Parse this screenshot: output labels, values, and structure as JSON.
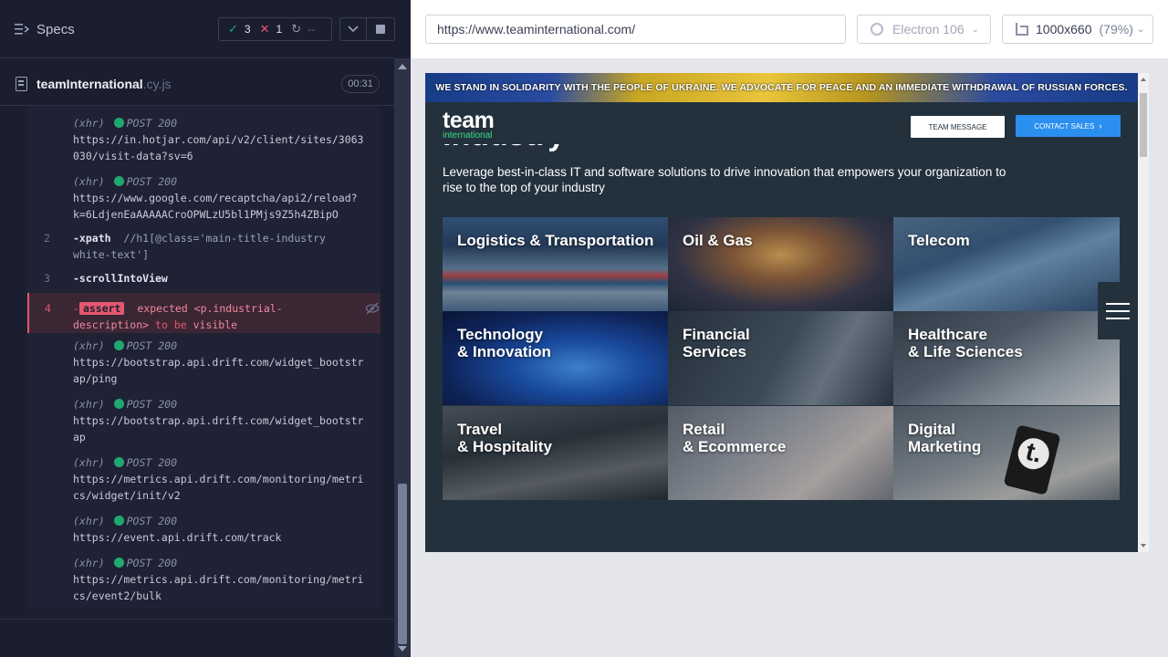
{
  "reporter": {
    "specs_label": "Specs",
    "stats": {
      "passed": "3",
      "failed": "1",
      "pending": "--"
    },
    "spec": {
      "name": "teamInternational",
      "ext": ".cy.js",
      "time": "00:31"
    },
    "commands": [
      {
        "type": "xhr",
        "label": "(xhr)",
        "method": "POST 200",
        "url_lines": [
          "https://in.hotjar.com/api/v2/client/sites/3063",
          "030/visit-data?sv=6"
        ]
      },
      {
        "type": "xhr",
        "label": "(xhr)",
        "method": "POST 200",
        "url_lines": [
          "https://www.google.com/recaptcha/api2/reload?",
          "k=6LdjenEaAAAAACroOPWLzU5bl1PMjs9Z5h4ZBipO"
        ]
      },
      {
        "type": "cmd",
        "num": "2",
        "name": "-xpath",
        "arg_lines": [
          "//h1[@class='main-title-industry",
          "white-text']"
        ]
      },
      {
        "type": "cmd",
        "num": "3",
        "name": "-scrollIntoView"
      },
      {
        "type": "assert",
        "num": "4",
        "badge": "assert",
        "dash": "-",
        "line1": "expected <p.industrial-",
        "line2_a": "description>",
        "line2_b": "to be",
        "line2_c": "visible"
      },
      {
        "type": "xhr",
        "label": "(xhr)",
        "method": "POST 200",
        "url_lines": [
          "https://bootstrap.api.drift.com/widget_bootstr",
          "ap/ping"
        ]
      },
      {
        "type": "xhr",
        "label": "(xhr)",
        "method": "POST 200",
        "url_lines": [
          "https://bootstrap.api.drift.com/widget_bootstr",
          "ap"
        ]
      },
      {
        "type": "xhr",
        "label": "(xhr)",
        "method": "POST 200",
        "url_lines": [
          "https://metrics.api.drift.com/monitoring/metri",
          "cs/widget/init/v2"
        ]
      },
      {
        "type": "xhr",
        "label": "(xhr)",
        "method": "POST 200",
        "url_lines": [
          "https://event.api.drift.com/track"
        ]
      },
      {
        "type": "xhr",
        "label": "(xhr)",
        "method": "POST 200",
        "url_lines": [
          "https://metrics.api.drift.com/monitoring/metri",
          "cs/event2/bulk"
        ]
      }
    ]
  },
  "aut": {
    "url": "https://www.teaminternational.com/",
    "browser": "Electron 106",
    "viewport": "1000x660",
    "scale": "(79%)",
    "site": {
      "banner": "WE STAND IN SOLIDARITY WITH THE PEOPLE OF UKRAINE. WE ADVOCATE FOR PEACE AND AN IMMEDIATE WITHDRAWAL OF RUSSIAN FORCES.",
      "logo_top": "team",
      "logo_bottom": "international",
      "btn_team": "TEAM MESSAGE",
      "btn_contact": "CONTACT SALES",
      "heading": "Industry",
      "description": "Leverage best-in-class IT and software solutions to drive innovation that empowers your organization to rise to the top of your industry",
      "tiles": [
        {
          "line1": "Logistics & Transportation",
          "line2": ""
        },
        {
          "line1": "Oil & Gas",
          "line2": ""
        },
        {
          "line1": "Telecom",
          "line2": ""
        },
        {
          "line1": "Technology",
          "line2": "& Innovation"
        },
        {
          "line1": "Financial",
          "line2": "Services"
        },
        {
          "line1": "Healthcare",
          "line2": "& Life Sciences"
        },
        {
          "line1": "Travel",
          "line2": "& Hospitality"
        },
        {
          "line1": "Retail",
          "line2": "& Ecommerce"
        },
        {
          "line1": "Digital",
          "line2": "Marketing"
        }
      ],
      "digital_logo_glyph": "t."
    }
  },
  "colors": {
    "pass": "#1fa971",
    "fail": "#e45770",
    "accent_blue": "#2b8ff0",
    "logo_green": "#3ddc84"
  }
}
